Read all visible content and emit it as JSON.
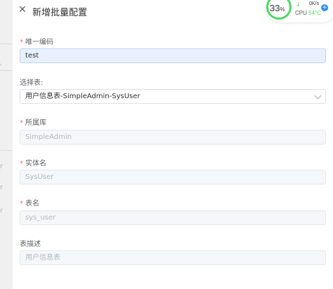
{
  "drawer": {
    "close_icon": "close-icon",
    "title": "新增批量配置"
  },
  "form": {
    "unique_code": {
      "label": "唯一编码",
      "required": true,
      "value": "test"
    },
    "table_select": {
      "label": "选择表:",
      "required": false,
      "value": "用户信息表-SimpleAdmin-SysUser"
    },
    "library": {
      "label": "所属库",
      "required": true,
      "value": "SimpleAdmin"
    },
    "entity_name": {
      "label": "实体名",
      "required": true,
      "value": "SysUser"
    },
    "table_name": {
      "label": "表名",
      "required": true,
      "value": "sys_user"
    },
    "table_desc": {
      "label": "表描述",
      "required": false,
      "value": "用户信息表"
    }
  },
  "monitor": {
    "percent": "33",
    "percent_unit": "%",
    "net_speed": "0K/s",
    "cpu_label": "CPU",
    "cpu_temp": "54°C",
    "accent": "#4cd964"
  }
}
